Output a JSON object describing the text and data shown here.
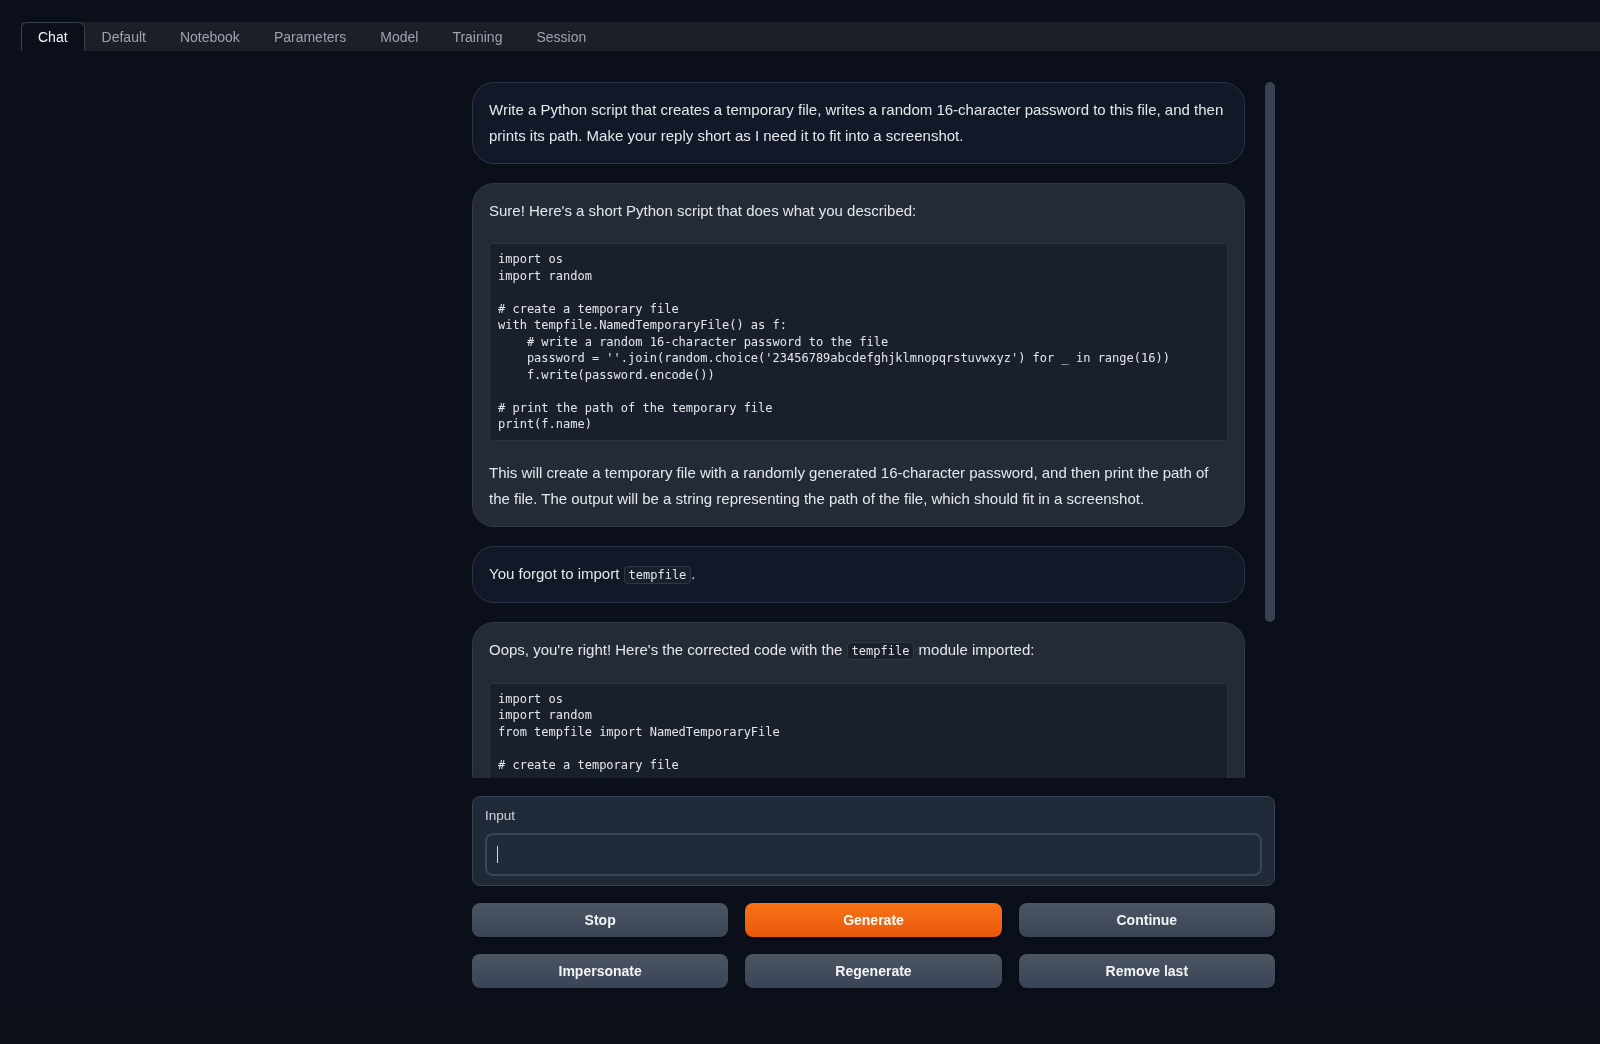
{
  "tabs": [
    {
      "label": "Chat",
      "selected": true
    },
    {
      "label": "Default",
      "selected": false
    },
    {
      "label": "Notebook",
      "selected": false
    },
    {
      "label": "Parameters",
      "selected": false
    },
    {
      "label": "Model",
      "selected": false
    },
    {
      "label": "Training",
      "selected": false
    },
    {
      "label": "Session",
      "selected": false
    }
  ],
  "chat": {
    "messages": [
      {
        "kind": "user",
        "blocks": [
          {
            "kind": "text",
            "segments": [
              {
                "kind": "plain",
                "text": "Write a Python script that creates a temporary file, writes a random 16-character password to this file, and then prints its path. Make your reply short as I need it to fit into a screenshot."
              }
            ]
          }
        ]
      },
      {
        "kind": "bot",
        "blocks": [
          {
            "kind": "text",
            "segments": [
              {
                "kind": "plain",
                "text": "Sure! Here's a short Python script that does what you described:"
              }
            ]
          },
          {
            "kind": "code",
            "text": "import os\nimport random\n\n# create a temporary file\nwith tempfile.NamedTemporaryFile() as f:\n    # write a random 16-character password to the file\n    password = ''.join(random.choice('23456789abcdefghjklmnopqrstuvwxyz') for _ in range(16))\n    f.write(password.encode())\n\n# print the path of the temporary file\nprint(f.name)"
          },
          {
            "kind": "text",
            "segments": [
              {
                "kind": "plain",
                "text": "This will create a temporary file with a randomly generated 16-character password, and then print the path of the file. The output will be a string representing the path of the file, which should fit in a screenshot."
              }
            ]
          }
        ]
      },
      {
        "kind": "user",
        "blocks": [
          {
            "kind": "text",
            "segments": [
              {
                "kind": "plain",
                "text": "You forgot to import "
              },
              {
                "kind": "code",
                "text": "tempfile"
              },
              {
                "kind": "plain",
                "text": "."
              }
            ]
          }
        ]
      },
      {
        "kind": "bot",
        "blocks": [
          {
            "kind": "text",
            "segments": [
              {
                "kind": "plain",
                "text": "Oops, you're right! Here's the corrected code with the "
              },
              {
                "kind": "code",
                "text": "tempfile"
              },
              {
                "kind": "plain",
                "text": " module imported:"
              }
            ]
          },
          {
            "kind": "code",
            "text": "import os\nimport random\nfrom tempfile import NamedTemporaryFile\n\n# create a temporary file"
          }
        ]
      }
    ]
  },
  "input": {
    "label": "Input",
    "focused": true
  },
  "buttons": [
    {
      "label": "Stop",
      "kind": "secondary"
    },
    {
      "label": "Generate",
      "kind": "primary"
    },
    {
      "label": "Continue",
      "kind": "secondary"
    },
    {
      "label": "Impersonate",
      "kind": "secondary"
    },
    {
      "label": "Regenerate",
      "kind": "secondary"
    },
    {
      "label": "Remove last",
      "kind": "secondary"
    }
  ]
}
